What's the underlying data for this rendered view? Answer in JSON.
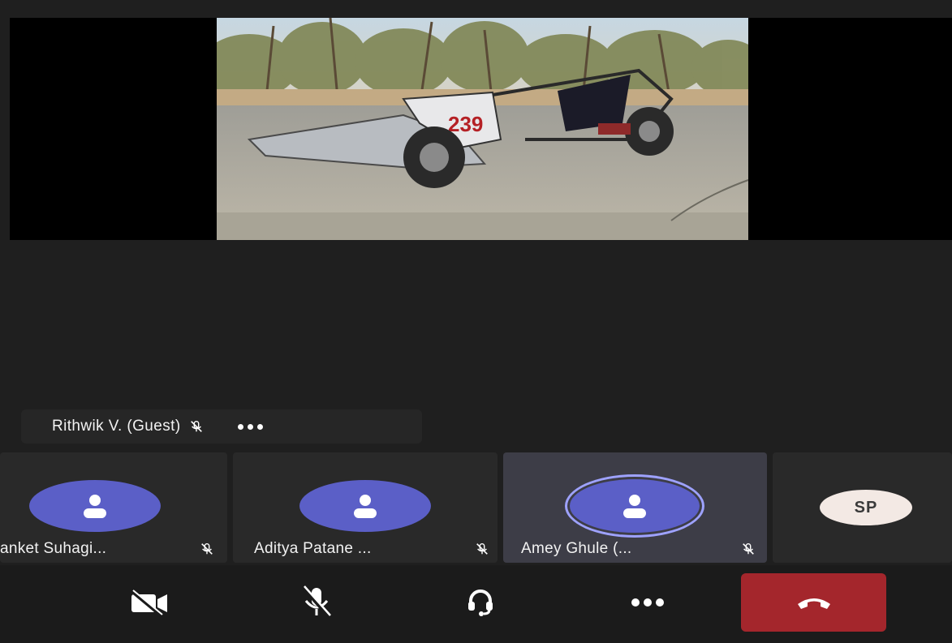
{
  "meeting": {
    "presenter": {
      "name": "Rithwik V. (Guest)",
      "muted": true
    },
    "participants": [
      {
        "name": "anket Suhagi...",
        "avatar": "person-icon",
        "muted": true,
        "active": false
      },
      {
        "name": "Aditya Patane ...",
        "avatar": "person-icon",
        "muted": true,
        "active": false
      },
      {
        "name": "Amey Ghule (...",
        "avatar": "person-icon",
        "muted": true,
        "active": true
      },
      {
        "name": "",
        "initials": "SP",
        "muted": false,
        "active": false
      }
    ]
  },
  "shared_video": {
    "overlay_number": "239"
  },
  "controls": {
    "camera": "camera-off-icon",
    "mic": "mic-off-icon",
    "audio": "headset-icon",
    "more": "more-icon",
    "hangup": "hangup-icon"
  },
  "colors": {
    "background": "#1f1f1f",
    "avatar": "#5b5fc7",
    "active_tile": "#3d3d47",
    "hangup": "#a4262c",
    "initials_avatar": "#f3e9e4"
  }
}
